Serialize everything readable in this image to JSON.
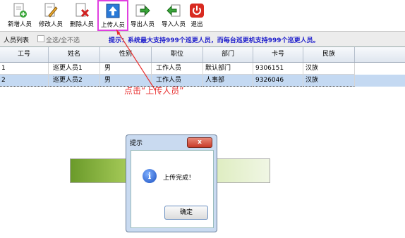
{
  "toolbar": {
    "buttons": [
      {
        "label": "新增人员",
        "icon": "add-user-icon"
      },
      {
        "label": "修改人员",
        "icon": "edit-user-icon"
      },
      {
        "label": "删除人员",
        "icon": "delete-user-icon"
      },
      {
        "label": "上传人员",
        "icon": "upload-icon"
      },
      {
        "label": "导出人员",
        "icon": "export-icon"
      },
      {
        "label": "导入人员",
        "icon": "import-icon"
      },
      {
        "label": "退出",
        "icon": "power-icon"
      }
    ]
  },
  "subbar": {
    "title": "人员列表",
    "select_all": "全选/全不选",
    "hint": "提示：系统最大支持999个巡更人员，而每台巡更机支持999个巡更人员。"
  },
  "table": {
    "columns": [
      "工号",
      "姓名",
      "性别",
      "职位",
      "部门",
      "卡号",
      "民族"
    ],
    "rows": [
      [
        "1",
        "巡更人员1",
        "男",
        "工作人员",
        "默认部门",
        "9306151",
        "汉族"
      ],
      [
        "2",
        "巡更人员2",
        "男",
        "工作人员",
        "人事部",
        "9326046",
        "汉族"
      ]
    ]
  },
  "annotation": "点击“上传人员”",
  "dialog": {
    "title": "提示",
    "message": "上传完成！",
    "ok_label": "确定",
    "close_label": "x"
  },
  "colors": {
    "highlight": "#e040e0",
    "annotation": "#e83030",
    "hint": "#2020cc",
    "selected_row": "#c4d9f2"
  }
}
